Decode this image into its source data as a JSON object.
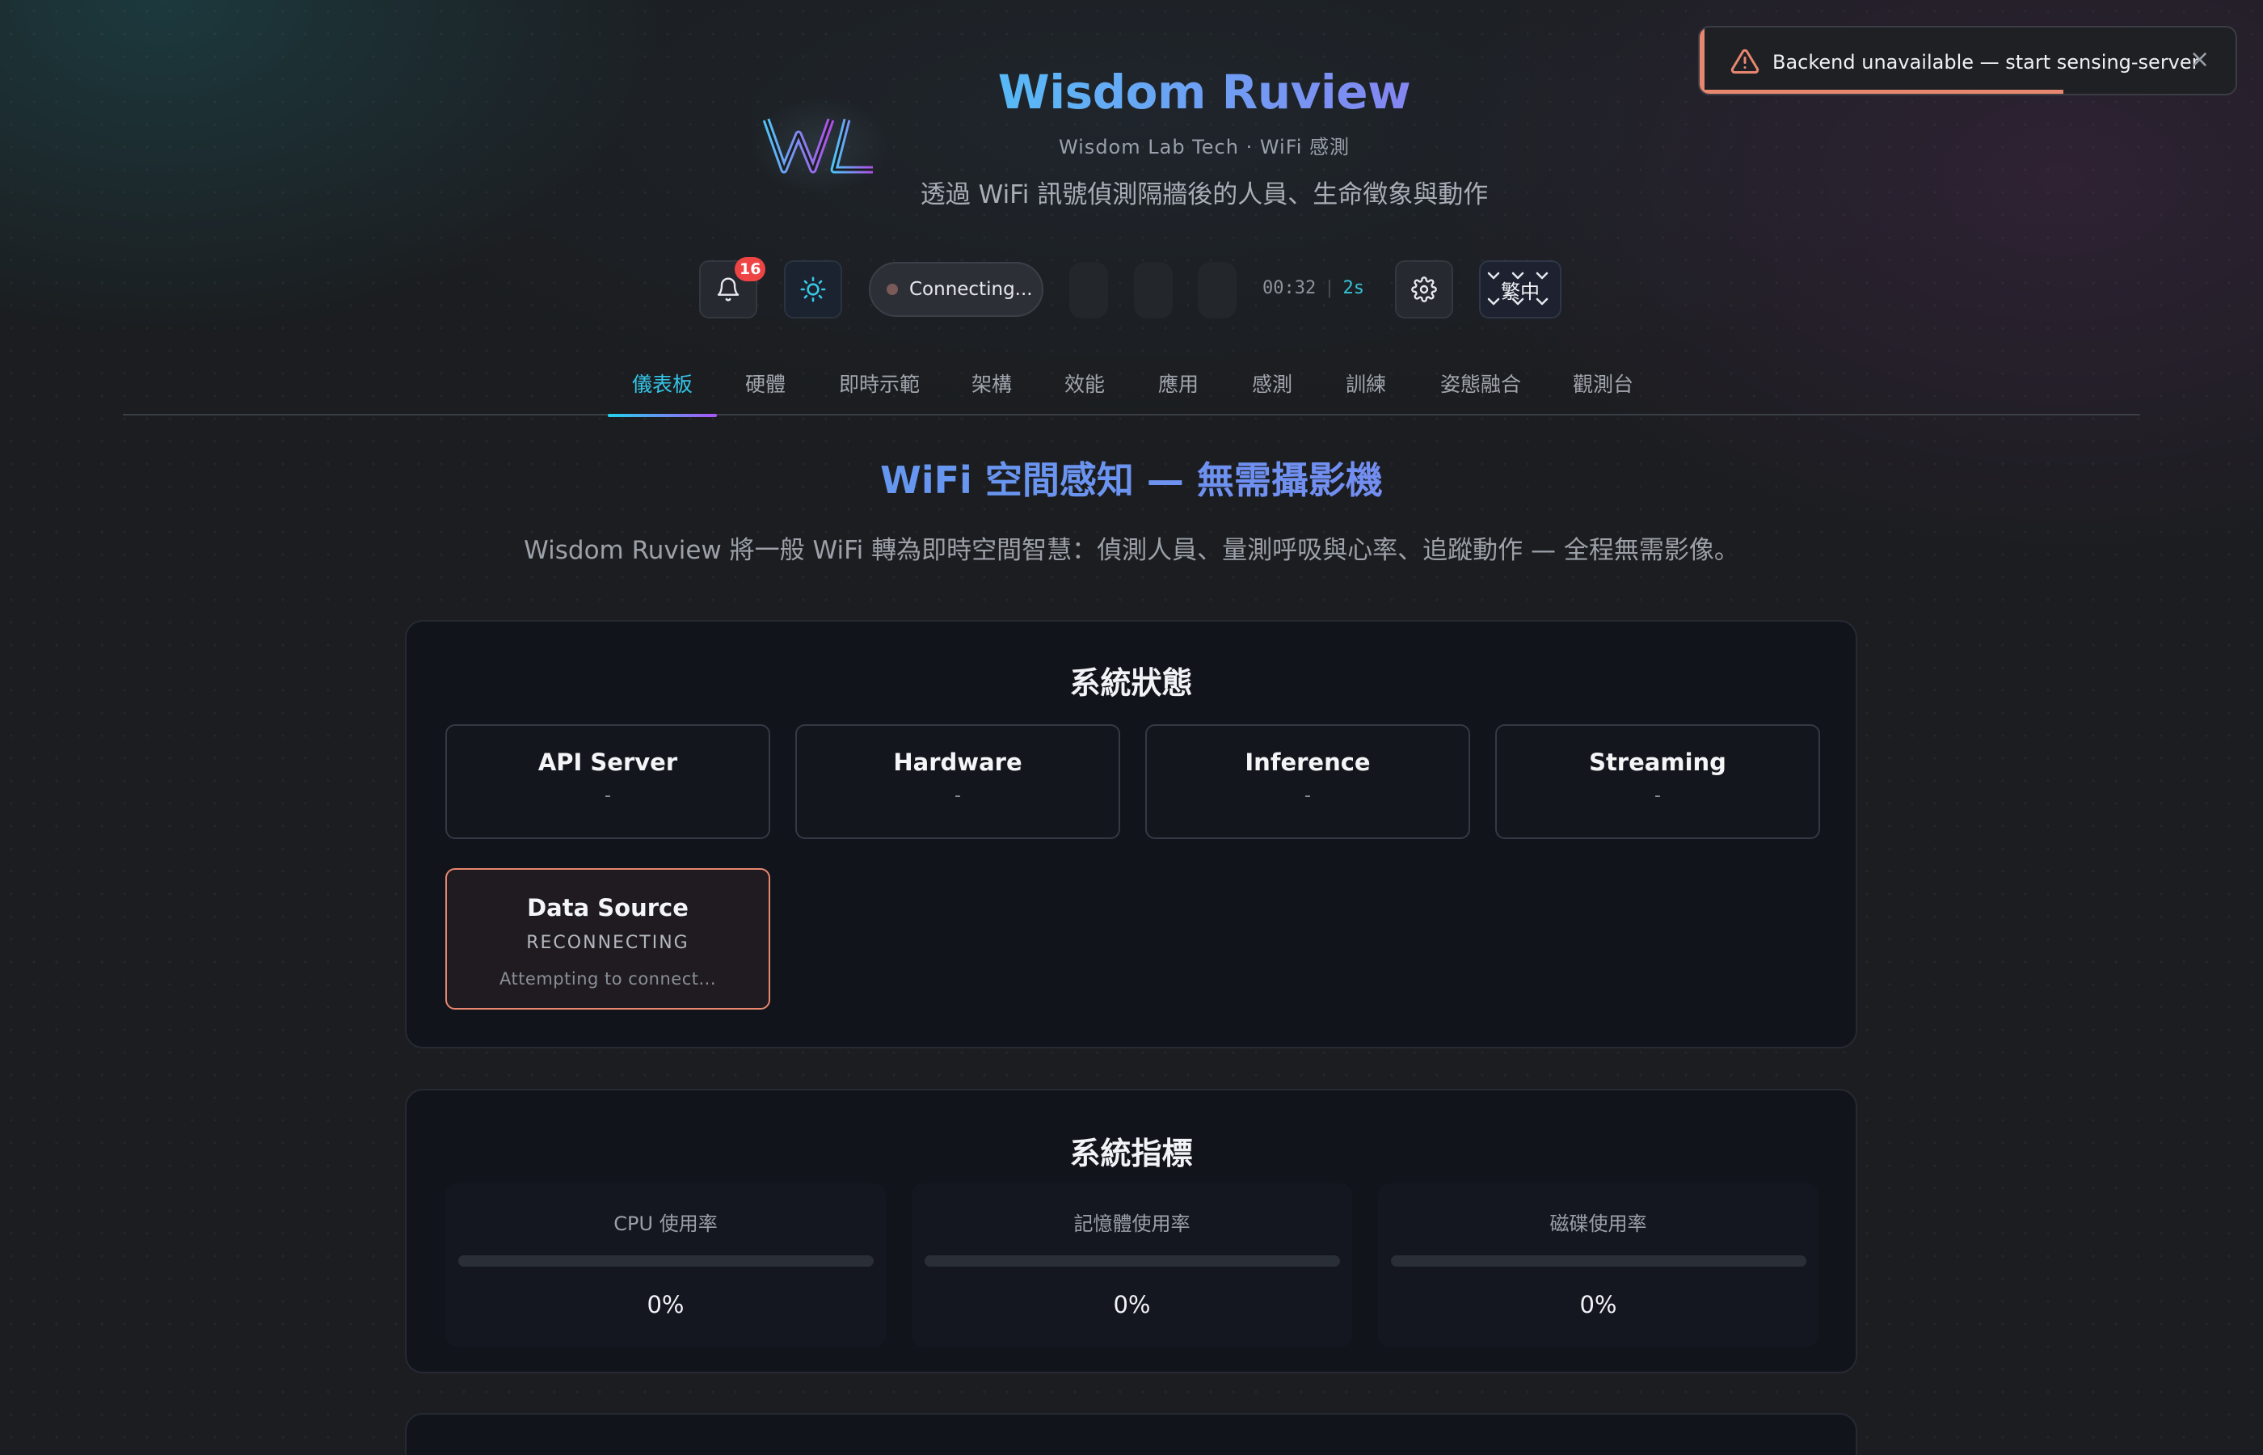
{
  "app": {
    "title": "Wisdom Ruview",
    "subtitle": "Wisdom Lab Tech · WiFi 感測",
    "tagline": "透過 WiFi 訊號偵測隔牆後的人員、生命徵象與動作"
  },
  "toolbar": {
    "notification_count": "16",
    "connection_status": "Connecting...",
    "timer": "00:32",
    "timer_sep": "|",
    "refresh_interval": "2s",
    "language_label": "繁中"
  },
  "tabs": [
    {
      "label": "儀表板",
      "active": true
    },
    {
      "label": "硬體"
    },
    {
      "label": "即時示範"
    },
    {
      "label": "架構"
    },
    {
      "label": "效能"
    },
    {
      "label": "應用"
    },
    {
      "label": "感測"
    },
    {
      "label": "訓練"
    },
    {
      "label": "姿態融合"
    },
    {
      "label": "觀測台"
    }
  ],
  "hero": {
    "title": "WiFi 空間感知 — 無需攝影機",
    "description": "Wisdom Ruview 將一般 WiFi 轉為即時空間智慧：偵測人員、量測呼吸與心率、追蹤動作 — 全程無需影像。"
  },
  "status_panel": {
    "title": "系統狀態",
    "cards": [
      {
        "name": "API Server",
        "value": "-"
      },
      {
        "name": "Hardware",
        "value": "-"
      },
      {
        "name": "Inference",
        "value": "-"
      },
      {
        "name": "Streaming",
        "value": "-"
      }
    ],
    "data_source": {
      "name": "Data Source",
      "state": "RECONNECTING",
      "detail": "Attempting to connect..."
    }
  },
  "metrics_panel": {
    "title": "系統指標",
    "items": [
      {
        "label": "CPU 使用率",
        "value": "0%",
        "fraction": 0
      },
      {
        "label": "記憶體使用率",
        "value": "0%",
        "fraction": 0
      },
      {
        "label": "磁碟使用率",
        "value": "0%",
        "fraction": 0
      }
    ]
  },
  "toast": {
    "message": "Backend unavailable — start sensing-server",
    "close": "×",
    "remaining_fraction": 0.67
  },
  "colors": {
    "accent_cyan": "#22d3ee",
    "accent_purple": "#a855f7",
    "warning": "#e8876f",
    "badge_red": "#ef4444"
  }
}
